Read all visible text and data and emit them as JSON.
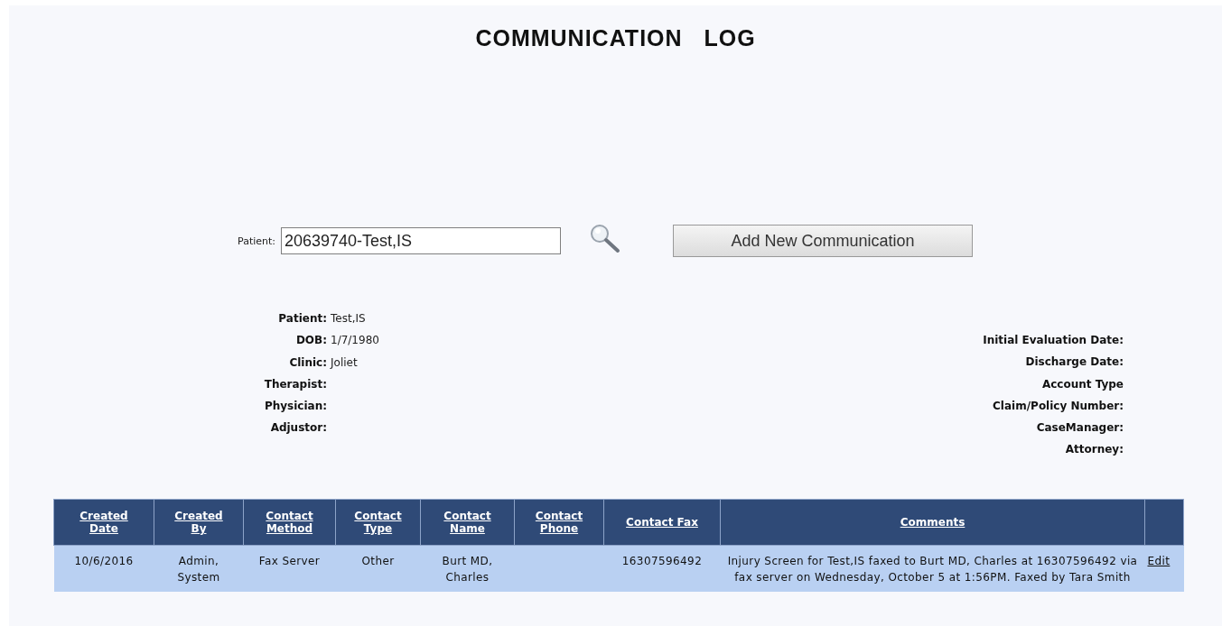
{
  "title": "COMMUNICATION   LOG",
  "patient_search": {
    "label": "Patient:",
    "value": "20639740-Test,IS"
  },
  "add_button": "Add New Communication",
  "info_left": [
    {
      "label": "Patient:",
      "value": "Test,IS"
    },
    {
      "label": "DOB:",
      "value": "1/7/1980"
    },
    {
      "label": "Clinic:",
      "value": "Joliet"
    },
    {
      "label": "Therapist:"
    },
    {
      "label": "Physician:"
    },
    {
      "label": "Adjustor:"
    }
  ],
  "info_right": [
    {
      "label": "Initial Evaluation Date:"
    },
    {
      "label": "Discharge Date:"
    },
    {
      "label": "Account Type"
    },
    {
      "label": "Claim/Policy Number:"
    },
    {
      "label": "CaseManager:"
    },
    {
      "label": "Attorney:"
    }
  ],
  "table": {
    "columns": [
      "Created Date",
      "Created By",
      "Contact Method",
      "Contact Type",
      "Contact Name",
      "Contact Phone",
      "Contact Fax",
      "Comments"
    ],
    "rows": [
      {
        "cells": [
          "10/6/2016",
          "Admin, System",
          "Fax Server",
          "Other",
          "Burt MD, Charles",
          "",
          "16307596492",
          "Injury Screen for Test,IS faxed to Burt MD, Charles at 16307596492 via fax server on Wednesday, October 5 at 1:56PM. Faxed by Tara Smith"
        ],
        "action": "Edit"
      }
    ]
  }
}
